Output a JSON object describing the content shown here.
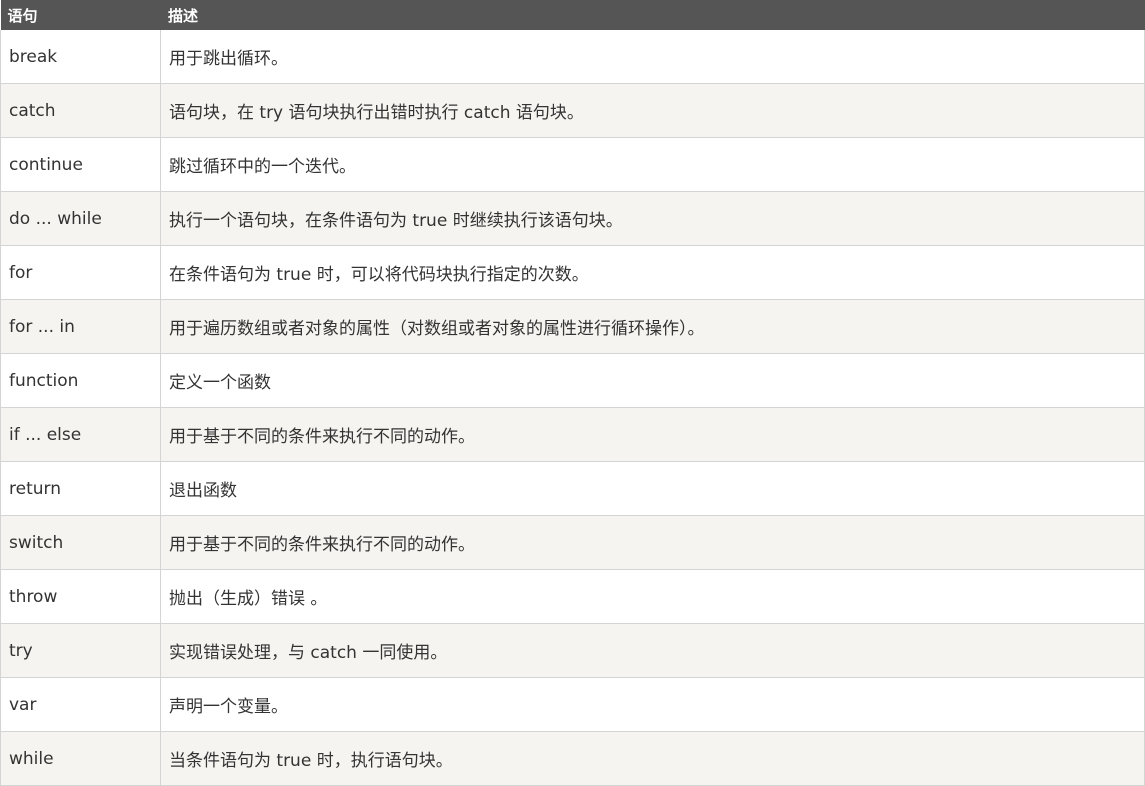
{
  "table": {
    "headers": {
      "statement": "语句",
      "description": "描述"
    },
    "rows": [
      {
        "statement": "break",
        "description": "用于跳出循环。"
      },
      {
        "statement": "catch",
        "description": "语句块，在 try 语句块执行出错时执行 catch 语句块。"
      },
      {
        "statement": "continue",
        "description": "跳过循环中的一个迭代。"
      },
      {
        "statement": "do ... while",
        "description": "执行一个语句块，在条件语句为 true 时继续执行该语句块。"
      },
      {
        "statement": "for",
        "description": "在条件语句为 true 时，可以将代码块执行指定的次数。"
      },
      {
        "statement": "for ... in",
        "description": "用于遍历数组或者对象的属性（对数组或者对象的属性进行循环操作）。"
      },
      {
        "statement": "function",
        "description": "定义一个函数"
      },
      {
        "statement": "if ... else",
        "description": "用于基于不同的条件来执行不同的动作。"
      },
      {
        "statement": "return",
        "description": "退出函数"
      },
      {
        "statement": "switch",
        "description": "用于基于不同的条件来执行不同的动作。"
      },
      {
        "statement": "throw",
        "description": "抛出（生成）错误 。"
      },
      {
        "statement": "try",
        "description": "实现错误处理，与 catch 一同使用。"
      },
      {
        "statement": "var",
        "description": "声明一个变量。"
      },
      {
        "statement": "while",
        "description": "当条件语句为 true 时，执行语句块。"
      }
    ]
  }
}
